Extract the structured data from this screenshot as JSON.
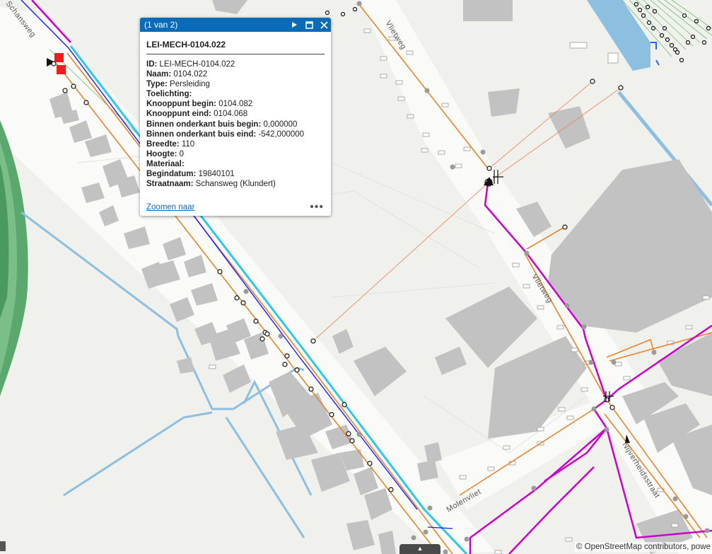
{
  "popup": {
    "counter": "(1 van 2)",
    "title": "LEI-MECH-0104.022",
    "attributes": [
      {
        "key": "ID:",
        "value": " LEI-MECH-0104.022"
      },
      {
        "key": "Naam:",
        "value": " 0104.022"
      },
      {
        "key": "Type:",
        "value": " Persleiding"
      },
      {
        "key": "Toelichting:",
        "value": ""
      },
      {
        "key": "Knooppunt begin:",
        "value": " 0104.082"
      },
      {
        "key": "Knooppunt eind:",
        "value": " 0104.068"
      },
      {
        "key": "Binnen onderkant buis begin:",
        "value": " 0,000000"
      },
      {
        "key": "Binnen onderkant buis eind:",
        "value": " -542,000000"
      },
      {
        "key": "Breedte:",
        "value": " 110"
      },
      {
        "key": "Hoogte:",
        "value": " 0"
      },
      {
        "key": "Materiaal:",
        "value": ""
      },
      {
        "key": "Begindatum:",
        "value": " 19840101"
      },
      {
        "key": "Straatnaam:",
        "value": " Schansweg (Klundert)"
      }
    ],
    "zoom_link": "Zoomen naar",
    "more_label": "•••",
    "icons": {
      "next": "play-next-icon",
      "maximize": "maximize-icon",
      "close": "close-icon"
    }
  },
  "map": {
    "street_labels": [
      "Schansweg",
      "Vlietweg",
      "Vlietweg",
      "Molenvliet",
      "Nijverheidsstraat"
    ],
    "attribution": "© OpenStreetMap contributors, powe",
    "colors": {
      "water": "#8cbfe0",
      "pressure_main": "#cc00cc",
      "gravity_main": "#e8842c",
      "selection": "#2dc7e8",
      "buildings": "#c2c2c2",
      "green": "#5aa86e",
      "popup_header": "#0a6bb8"
    }
  }
}
